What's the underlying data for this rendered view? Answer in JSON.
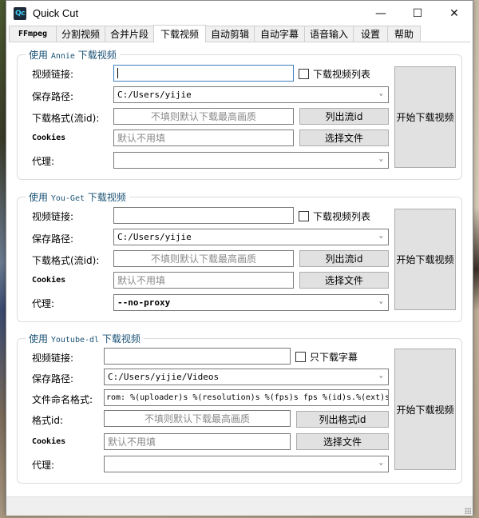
{
  "window": {
    "title": "Quick Cut",
    "icon_text": "Qc",
    "controls": {
      "minimize": "—",
      "maximize": "☐",
      "close": "✕"
    }
  },
  "tabs": [
    {
      "label": "FFmpeg",
      "active": false
    },
    {
      "label": "分割视频",
      "active": false
    },
    {
      "label": "合并片段",
      "active": false
    },
    {
      "label": "下载视频",
      "active": true
    },
    {
      "label": "自动剪辑",
      "active": false
    },
    {
      "label": "自动字幕",
      "active": false
    },
    {
      "label": "语音输入",
      "active": false
    },
    {
      "label": "设置",
      "active": false
    },
    {
      "label": "帮助",
      "active": false
    }
  ],
  "annie": {
    "title_prefix": "使用",
    "title_tool": "Annie",
    "title_suffix": "下载视频",
    "url_label": "视频链接:",
    "url_value": "",
    "checkbox_label": "下载视频列表",
    "checkbox_checked": false,
    "path_label": "保存路径:",
    "path_value": "C:/Users/yijie",
    "format_label": "下载格式(流id):",
    "format_placeholder": "不填则默认下载最高画质",
    "list_button": "列出流id",
    "cookies_label": "Cookies",
    "cookies_placeholder": "默认不用填",
    "choose_file_button": "选择文件",
    "proxy_label": "代理:",
    "proxy_value": "",
    "start_button": "开始下载视频"
  },
  "youget": {
    "title_prefix": "使用",
    "title_tool": "You-Get",
    "title_suffix": "下载视频",
    "url_label": "视频链接:",
    "url_value": "",
    "checkbox_label": "下载视频列表",
    "checkbox_checked": false,
    "path_label": "保存路径:",
    "path_value": "C:/Users/yijie",
    "format_label": "下载格式(流id):",
    "format_placeholder": "不填则默认下载最高画质",
    "list_button": "列出流id",
    "cookies_label": "Cookies",
    "cookies_placeholder": "默认不用填",
    "choose_file_button": "选择文件",
    "proxy_label": "代理:",
    "proxy_value": "--no-proxy",
    "start_button": "开始下载视频"
  },
  "youtubedl": {
    "title_prefix": "使用",
    "title_tool": "Youtube-dl",
    "title_suffix": "下载视频",
    "url_label": "视频链接:",
    "url_value": "",
    "checkbox_label": "只下载字幕",
    "checkbox_checked": false,
    "path_label": "保存路径:",
    "path_value": "C:/Users/yijie/Videos",
    "naming_label": "文件命名格式:",
    "naming_value": "rom: %(uploader)s %(resolution)s %(fps)s fps %(id)s.%(ext)s",
    "format_label": "格式id:",
    "format_placeholder": "不填则默认下载最高画质",
    "list_button": "列出格式id",
    "cookies_label": "Cookies",
    "cookies_placeholder": "默认不用填",
    "choose_file_button": "选择文件",
    "proxy_label": "代理:",
    "proxy_value": "",
    "start_button": "开始下载视频"
  }
}
